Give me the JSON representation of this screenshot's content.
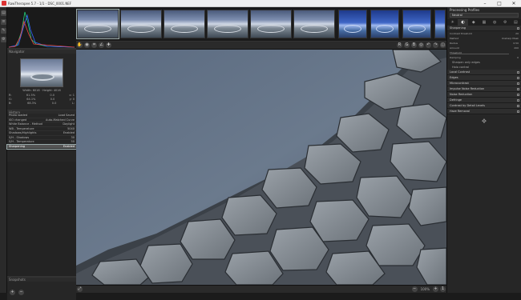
{
  "window": {
    "title": "RawTherapee 5.7 - 1/1 - DSC_0001.NEF"
  },
  "left": {
    "navigator_header": "Navigator",
    "nav_info": "Width: 6016 · Height: 4016",
    "nav_rows": [
      {
        "label": "R:",
        "v1": "61.5%",
        "v2": "0.0",
        "v3": "x: 1"
      },
      {
        "label": "G:",
        "v1": "64.1%",
        "v2": "0.0",
        "v3": "y: 0"
      },
      {
        "label": "B:",
        "v1": "68.3%",
        "v2": "0.0",
        "v3": "L:"
      }
    ],
    "history_header": "History",
    "history": [
      {
        "name": "Photo loaded",
        "val": "Load Saved"
      },
      {
        "name": "ISO changed",
        "val": "Auto-Matched Curve"
      },
      {
        "name": "White Balance - Method",
        "val": "Daylight"
      },
      {
        "name": "WB - Temperature",
        "val": "5040"
      },
      {
        "name": "Shadows/Highlights",
        "val": "Enabled"
      },
      {
        "name": "S/H - Shadows",
        "val": "30"
      },
      {
        "name": "S/H - Temperature",
        "val": "50"
      },
      {
        "name": "Sharpening",
        "val": "Enabled"
      }
    ],
    "snapshots_header": "Snapshots"
  },
  "right": {
    "title": "Processing Profiles",
    "profile": "Neutral",
    "tabs": [
      "☀",
      "◐",
      "◆",
      "▦",
      "◍",
      "⚙",
      "▤"
    ],
    "sections_top": [
      {
        "name": "Sharpening",
        "on": true
      }
    ],
    "sharp_rows": [
      {
        "label": "Contrast threshold",
        "val": "20"
      },
      {
        "label": "Method",
        "val": "Unsharp Mask"
      },
      {
        "label": "Radius",
        "val": "0.50"
      },
      {
        "label": "Amount",
        "val": "200"
      },
      {
        "label": "Threshold",
        "val": ""
      },
      {
        "label": "Damping",
        "val": "0"
      }
    ],
    "sharp_extras": [
      "Sharpen only edges",
      "Halo control"
    ],
    "sections_bottom": [
      "Local Contrast",
      "Edges",
      "Microcontrast",
      "Impulse Noise Reduction",
      "Noise Reduction",
      "Defringe",
      "Contrast by Detail Levels",
      "Haze Removal"
    ]
  },
  "bottom": {
    "zoom": "100%"
  }
}
